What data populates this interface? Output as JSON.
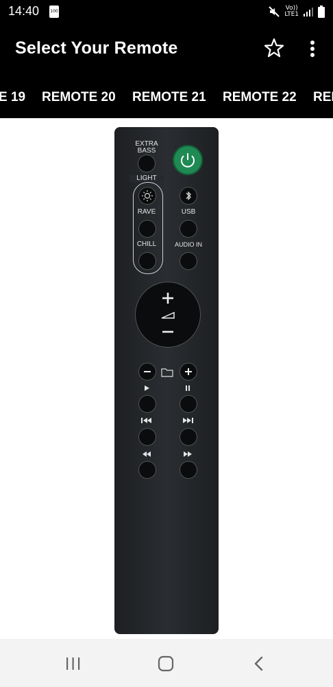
{
  "status": {
    "time": "14:40",
    "battery": "100",
    "net_top": "Vo))",
    "net_bottom": "LTE1"
  },
  "appbar": {
    "title": "Select Your Remote"
  },
  "tabs": [
    "E 19",
    "REMOTE 20",
    "REMOTE 21",
    "REMOTE 22",
    "REM"
  ],
  "remote": {
    "extra_bass": "EXTRA BASS",
    "light": "LIGHT",
    "rave": "RAVE",
    "usb": "USB",
    "chill": "CHILL",
    "audio_in": "AUDIO IN"
  },
  "colors": {
    "power": "#1f8a53",
    "bar": "#000000"
  }
}
